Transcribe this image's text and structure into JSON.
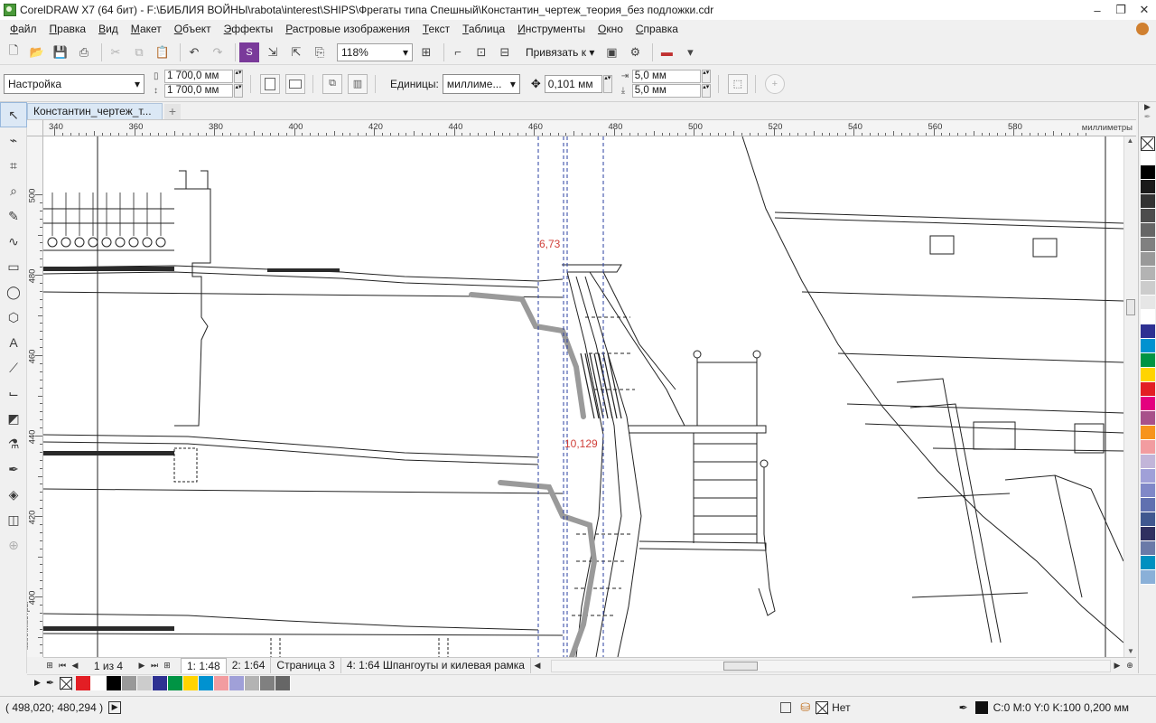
{
  "window": {
    "title": "CorelDRAW X7 (64 бит) - F:\\БИБЛИЯ ВОЙНЫ\\rabota\\interest\\SHIPS\\Фрегаты типа Спешный\\Константин_чертеж_теория_без подложки.cdr",
    "minimize": "–",
    "restore": "❐",
    "close": "✕"
  },
  "menu": [
    "Файл",
    "Правка",
    "Вид",
    "Макет",
    "Объект",
    "Эффекты",
    "Растровые изображения",
    "Текст",
    "Таблица",
    "Инструменты",
    "Окно",
    "Справка"
  ],
  "toolbar": {
    "zoom": "118%",
    "snap_label": "Привязать к"
  },
  "propbar": {
    "preset": "Настройка",
    "width": "1 700,0 мм",
    "height": "1 700,0 мм",
    "units_label": "Единицы:",
    "units_value": "миллиме...",
    "nudge": "0,101 мм",
    "dup_x": "5,0 мм",
    "dup_y": "5,0 мм"
  },
  "doc_tab": {
    "title": "Константин_чертеж_т...",
    "add": "+"
  },
  "ruler": {
    "units": "миллиметры",
    "h_ticks": [
      "340",
      "360",
      "380",
      "400",
      "420",
      "440",
      "460",
      "480",
      "500",
      "520",
      "540",
      "560",
      "580"
    ],
    "v_ticks": [
      "500",
      "480",
      "460",
      "440",
      "420",
      "400"
    ]
  },
  "drawing": {
    "dim1": "6,73",
    "dim2": "10,129"
  },
  "pages": {
    "count": "1 из 4",
    "tabs": [
      "1: 1:48",
      "2: 1:64",
      "Страница 3",
      "4: 1:64 Шпангоуты и килевая рамка"
    ]
  },
  "status": {
    "coords": "( 498,020; 480,294 )",
    "fill_label": "Нет",
    "outline": "C:0 M:0 Y:0 K:100  0,200 мм"
  },
  "colors": {
    "accent_blue": "#2a3fa0",
    "dimension_red": "#d0403a",
    "tab_blue": "#dbe8f5"
  },
  "palette_right": [
    "#ffffff",
    "#000000",
    "#1a1a1a",
    "#333333",
    "#4d4d4d",
    "#666666",
    "#808080",
    "#999999",
    "#b3b3b3",
    "#cccccc",
    "#e6e6e6",
    "#ffffff",
    "#2e3192",
    "#0092d0",
    "#009444",
    "#ffd400",
    "#e31e24",
    "#e4007f",
    "#a8518a",
    "#f7941d",
    "#f29ca0",
    "#c2b5d9",
    "#a0a0d8",
    "#8088c8",
    "#6070b0",
    "#405890",
    "#303060",
    "#6a7aa8",
    "#0090c0",
    "#8ab0d8"
  ],
  "palette_bottom": [
    "#e31e24",
    "#ffffff",
    "#000000",
    "#999999",
    "#cccccc",
    "#2e3192",
    "#009444",
    "#ffd400",
    "#0092d0",
    "#f29ca0",
    "#a0a0d8",
    "#b3b3b3",
    "#808080",
    "#666666"
  ]
}
